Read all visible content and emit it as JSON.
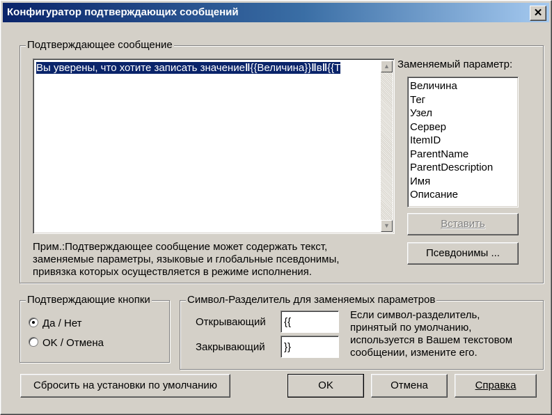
{
  "window": {
    "title": "Конфигуратор подтверждающих сообщений",
    "close_glyph": "✕",
    "close_icon": "close-icon"
  },
  "message_group": {
    "legend": "Подтверждающее сообщение",
    "text_plain": "Вы уверены, что хотите записать значение",
    "text_token1": "{{Величина}}",
    "text_word": "в",
    "text_token2": "{{Т",
    "scroll_up_glyph": "▲",
    "scroll_down_glyph": "▼",
    "note_line1": "Прим.:Подтверждающее сообщение может содержать текст,",
    "note_line2": "заменяемые параметры, языковые и глобальные псевдонимы,",
    "note_line3": "привязка которых осуществляется  в режиме исполнения."
  },
  "params": {
    "label": "Заменяемый параметр:",
    "items": [
      "Величина",
      "Тег",
      "Узел",
      "Сервер",
      "ItemID",
      "ParentName",
      "ParentDescription",
      "Имя",
      "Описание"
    ],
    "insert_button": "Вставить",
    "aliases_button": "Псевдонимы ..."
  },
  "confirm_buttons": {
    "legend": "Подтверждающие кнопки",
    "options": [
      "Да / Нет",
      "OK / Отмена"
    ],
    "selected_index": 0
  },
  "separator": {
    "legend": "Символ-Разделитель для заменяемых параметров",
    "opening_label": "Открывающий",
    "opening_value": "{{",
    "closing_label": "Закрывающий",
    "closing_value": "}}",
    "hint_line1": "Если символ-разделитель,",
    "hint_line2": "принятый по умолчанию,",
    "hint_line3": "используется в Вашем текстовом",
    "hint_line4": "сообщении, измените его."
  },
  "footer": {
    "reset_button": "Сбросить на установки по умолчанию",
    "ok_button": "OK",
    "cancel_button": "Отмена",
    "help_button": "Справка"
  },
  "colors": {
    "face": "#d4d0c8",
    "title_start": "#0a246a",
    "title_end": "#a6caf0",
    "selection": "#0a246a"
  }
}
